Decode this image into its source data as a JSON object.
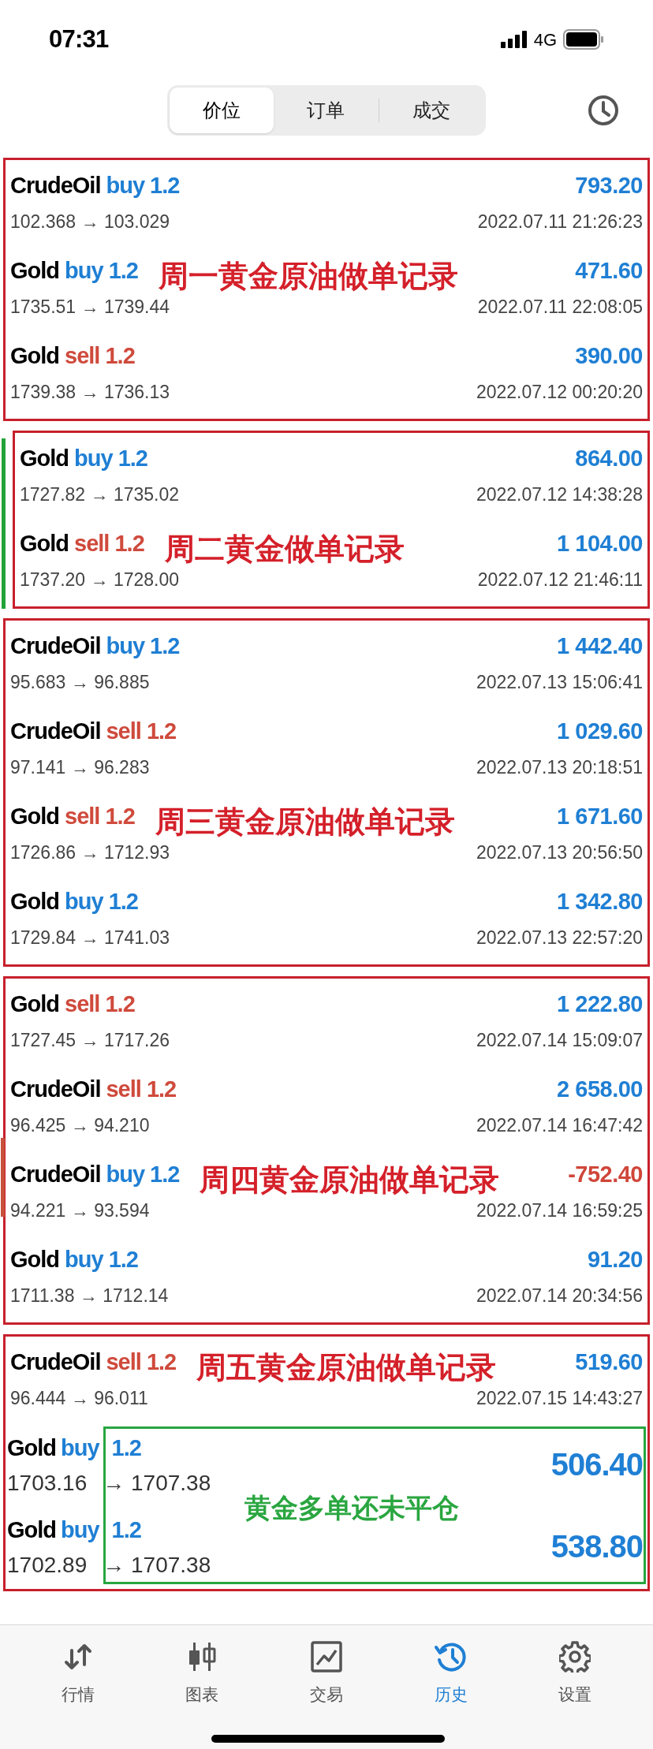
{
  "status_bar": {
    "time": "07:31",
    "network": "4G"
  },
  "segments": [
    {
      "label": "价位",
      "selected": true
    },
    {
      "label": "订单",
      "selected": false
    },
    {
      "label": "成交",
      "selected": false
    }
  ],
  "groups": [
    {
      "trades": [
        {
          "kind": "closed",
          "symbol": "CrudeOil",
          "order": "buy 1.2",
          "sell": false,
          "prices": "102.368 → 103.029",
          "time": "2022.07.11 21:26:23",
          "profit": "793.20",
          "loss": false
        },
        {
          "kind": "closed",
          "symbol": "Gold",
          "order": "buy 1.2",
          "sell": false,
          "prices": "1735.51 → 1739.44",
          "time": "2022.07.11 22:08:05",
          "profit": "471.60",
          "loss": false,
          "note": "周一黄金原油做单记录"
        },
        {
          "kind": "closed",
          "symbol": "Gold",
          "order": "sell 1.2",
          "sell": true,
          "prices": "1739.38 → 1736.13",
          "time": "2022.07.12 00:20:20",
          "profit": "390.00",
          "loss": false
        }
      ]
    },
    {
      "color": "#22a33a",
      "trades": [
        {
          "kind": "closed",
          "symbol": "Gold",
          "order": "buy 1.2",
          "sell": false,
          "prices": "1727.82 → 1735.02",
          "time": "2022.07.12 14:38:28",
          "profit": "864.00",
          "loss": false
        },
        {
          "kind": "closed",
          "symbol": "Gold",
          "order": "sell 1.2",
          "sell": true,
          "prices": "1737.20 → 1728.00",
          "time": "2022.07.12 21:46:11",
          "profit": "1 104.00",
          "loss": false,
          "note": "周二黄金做单记录"
        }
      ]
    },
    {
      "trades": [
        {
          "kind": "closed",
          "symbol": "CrudeOil",
          "order": "buy 1.2",
          "sell": false,
          "prices": "95.683 → 96.885",
          "time": "2022.07.13 15:06:41",
          "profit": "1 442.40",
          "loss": false
        },
        {
          "kind": "closed",
          "symbol": "CrudeOil",
          "order": "sell 1.2",
          "sell": true,
          "prices": "97.141 → 96.283",
          "time": "2022.07.13 20:18:51",
          "profit": "1 029.60",
          "loss": false
        },
        {
          "kind": "closed",
          "symbol": "Gold",
          "order": "sell 1.2",
          "sell": true,
          "prices": "1726.86 → 1712.93",
          "time": "2022.07.13 20:56:50",
          "profit": "1 671.60",
          "loss": false,
          "note": "周三黄金原油做单记录"
        },
        {
          "kind": "closed",
          "symbol": "Gold",
          "order": "buy 1.2",
          "sell": false,
          "prices": "1729.84 → 1741.03",
          "time": "2022.07.13 22:57:20",
          "profit": "1 342.80",
          "loss": false
        }
      ]
    },
    {
      "color": "#c9503c",
      "trades": [
        {
          "kind": "closed",
          "symbol": "Gold",
          "order": "sell 1.2",
          "sell": true,
          "prices": "1727.45 → 1717.26",
          "time": "2022.07.14 15:09:07",
          "profit": "1 222.80",
          "loss": false
        },
        {
          "kind": "closed",
          "symbol": "CrudeOil",
          "order": "sell 1.2",
          "sell": true,
          "prices": "96.425 → 94.210",
          "time": "2022.07.14 16:47:42",
          "profit": "2 658.00",
          "loss": false
        },
        {
          "kind": "closed",
          "symbol": "CrudeOil",
          "order": "buy 1.2",
          "sell": false,
          "prices": "94.221 → 93.594",
          "time": "2022.07.14 16:59:25",
          "profit": "-752.40",
          "loss": true,
          "note": "周四黄金原油做单记录"
        },
        {
          "kind": "closed",
          "symbol": "Gold",
          "order": "buy 1.2",
          "sell": false,
          "prices": "1711.38 → 1712.14",
          "time": "2022.07.14 20:34:56",
          "profit": "91.20",
          "loss": false
        }
      ]
    },
    {
      "open_note": "黄金多单还未平仓",
      "trades": [
        {
          "kind": "closed",
          "symbol": "CrudeOil",
          "order": "sell 1.2",
          "sell": true,
          "prices": "96.444 → 96.011",
          "time": "2022.07.15 14:43:27",
          "profit": "519.60",
          "loss": false,
          "note": "周五黄金原油做单记录"
        },
        {
          "kind": "open",
          "symbol": "Gold",
          "side": "buy",
          "volume": "1.2",
          "sell": false,
          "open_price": "1703.16",
          "current_price": "→ 1707.38",
          "profit": "506.40",
          "loss": false
        },
        {
          "kind": "open",
          "symbol": "Gold",
          "side": "buy",
          "volume": "1.2",
          "sell": false,
          "open_price": "1702.89",
          "current_price": "→ 1707.38",
          "profit": "538.80",
          "loss": false
        }
      ]
    }
  ],
  "tab_bar": [
    {
      "label": "行情",
      "selected": false
    },
    {
      "label": "图表",
      "selected": false
    },
    {
      "label": "交易",
      "selected": false
    },
    {
      "label": "历史",
      "selected": true
    },
    {
      "label": "设置",
      "selected": false
    }
  ]
}
